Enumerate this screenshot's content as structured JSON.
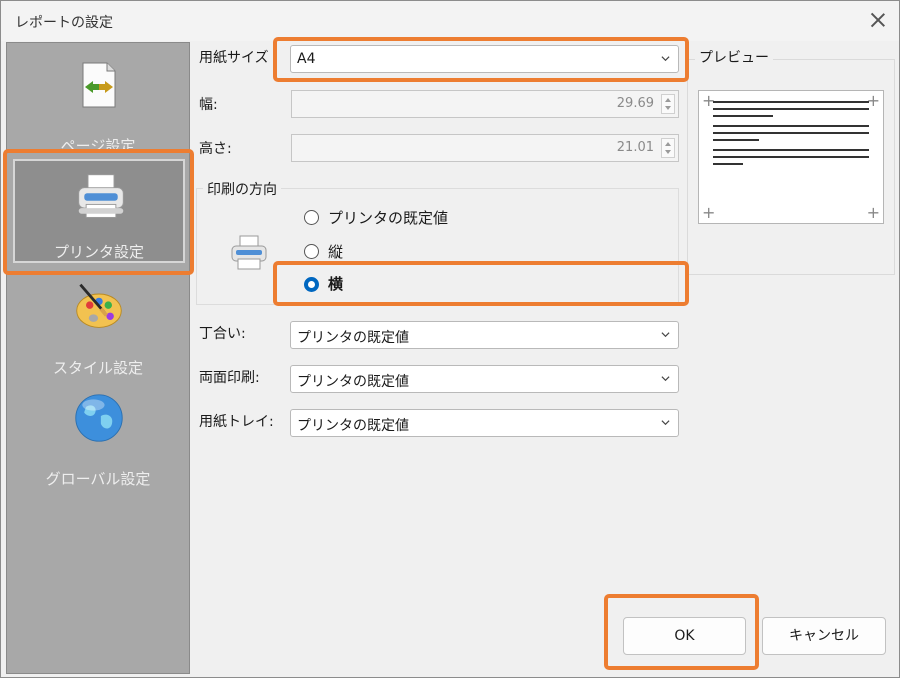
{
  "window": {
    "title": "レポートの設定"
  },
  "sidebar": {
    "items": [
      {
        "label": "ページ設定",
        "icon": "page-setup-icon"
      },
      {
        "label": "プリンタ設定",
        "icon": "printer-icon",
        "selected": true
      },
      {
        "label": "スタイル設定",
        "icon": "palette-icon"
      },
      {
        "label": "グローバル設定",
        "icon": "globe-icon"
      }
    ]
  },
  "form": {
    "paper_size": {
      "label": "用紙サイズ",
      "value": "A4"
    },
    "width": {
      "label": "幅:",
      "value": "29.69"
    },
    "height": {
      "label": "高さ:",
      "value": "21.01"
    },
    "orientation": {
      "title": "印刷の方向",
      "options": [
        {
          "label": "プリンタの既定値",
          "selected": false
        },
        {
          "label": "縦",
          "selected": false
        },
        {
          "label": "横",
          "selected": true
        }
      ]
    },
    "collate": {
      "label": "丁合い:",
      "value": "プリンタの既定値"
    },
    "duplex": {
      "label": "両面印刷:",
      "value": "プリンタの既定値"
    },
    "tray": {
      "label": "用紙トレイ:",
      "value": "プリンタの既定値"
    }
  },
  "preview": {
    "title": "プレビュー"
  },
  "buttons": {
    "ok": "OK",
    "cancel": "キャンセル"
  },
  "colors": {
    "highlight": "#ed7d31",
    "radio_selected": "#0067c0",
    "sidebar_bg": "#a8a8a8"
  }
}
